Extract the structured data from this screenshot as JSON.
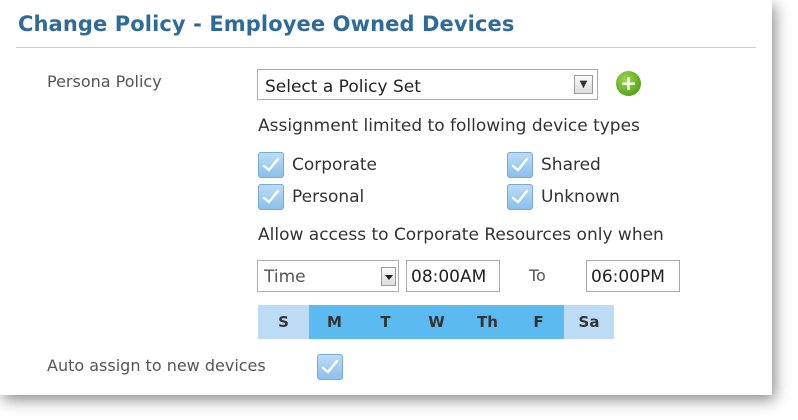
{
  "title": "Change Policy - Employee Owned Devices",
  "persona_policy": {
    "label": "Persona Policy",
    "select_value": "Select a Policy Set",
    "add_icon": "add-circle-icon"
  },
  "device_types": {
    "heading": "Assignment limited to following device types",
    "options": [
      {
        "label": "Corporate",
        "checked": true
      },
      {
        "label": "Shared",
        "checked": true
      },
      {
        "label": "Personal",
        "checked": true
      },
      {
        "label": "Unknown",
        "checked": true
      }
    ]
  },
  "access": {
    "heading": "Allow access to Corporate Resources only when",
    "condition": "Time",
    "from": "08:00AM",
    "to_label": "To",
    "to": "06:00PM"
  },
  "days": [
    {
      "label": "S",
      "selected": false
    },
    {
      "label": "M",
      "selected": true
    },
    {
      "label": "T",
      "selected": true
    },
    {
      "label": "W",
      "selected": true
    },
    {
      "label": "Th",
      "selected": true
    },
    {
      "label": "F",
      "selected": true
    },
    {
      "label": "Sa",
      "selected": false
    }
  ],
  "auto_assign": {
    "label": "Auto assign to new devices",
    "checked": true
  },
  "colors": {
    "title": "#2e6a9a",
    "day_selected": "#5bbaf0",
    "day_unselected": "#bcdcf6",
    "checkbox": "#8cc0ea",
    "add_button": "#5aa41b"
  }
}
